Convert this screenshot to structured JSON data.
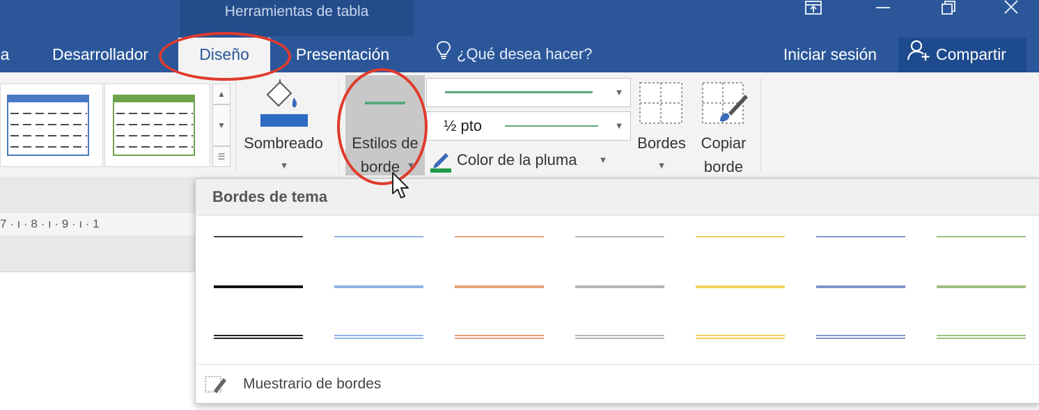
{
  "title_bar": {
    "context_tab_label": "Herramientas de tabla",
    "window_controls": [
      "ribbon-display-icon",
      "minimize-icon",
      "restore-icon",
      "close-icon"
    ]
  },
  "tabs": {
    "partial_left": "a",
    "desarrollador": "Desarrollador",
    "diseno": "Diseño",
    "presentacion": "Presentación",
    "tell_me": "¿Qué desea hacer?",
    "sign_in": "Iniciar sesión",
    "share": "Compartir"
  },
  "ribbon": {
    "sombreado": "Sombreado",
    "estilos_line1": "Estilos de",
    "estilos_line2": "borde",
    "pen_weight": "½ pto",
    "pen_color": "Color de la pluma",
    "bordes": "Bordes",
    "copiar_line1": "Copiar",
    "copiar_line2": "borde",
    "accent_green": "#5aa87a"
  },
  "ruler": {
    "text": "7 · ı · 8 · ı · 9 · ı · 1"
  },
  "dropdown": {
    "title": "Bordes de tema",
    "swatch_colors": [
      "#555555",
      "#8eb4e3",
      "#e6a078",
      "#b5b5b5",
      "#f0d25a",
      "#7f97c8",
      "#9fbf80"
    ],
    "row_styles": [
      "thin",
      "thick",
      "double"
    ],
    "footer_label": "Muestrario de bordes"
  }
}
